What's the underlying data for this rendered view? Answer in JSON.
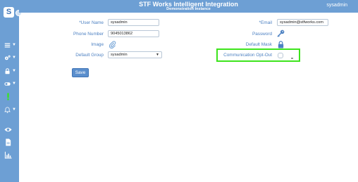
{
  "header": {
    "title": "STF Works Intelligent Integration",
    "subtitle": "Demonstration Instance",
    "user": "sysadmin"
  },
  "sidebar": {
    "logo": "S",
    "items": [
      {
        "icon": "menu-icon"
      },
      {
        "icon": "gears-icon"
      },
      {
        "icon": "lock-icon"
      },
      {
        "icon": "toggle-icon"
      },
      {
        "icon": "exclamation-icon",
        "color": "#36e61b"
      },
      {
        "icon": "bell-icon"
      },
      {
        "icon": "eye-icon"
      },
      {
        "icon": "document-icon"
      },
      {
        "icon": "bar-chart-icon"
      }
    ]
  },
  "form": {
    "user_name_label": "*User Name",
    "user_name_value": "sysadmin",
    "phone_label": "Phone Number",
    "phone_value": "9045013862",
    "image_label": "Image",
    "default_group_label": "Default Group",
    "default_group_value": "sysadmin",
    "email_label": "*Email",
    "email_value": "sysadmin@stfworks.com",
    "password_label": "Password",
    "default_mask_label": "Default Mask",
    "opt_out_label": "Communication Opt-Out",
    "save_label": "Save"
  },
  "colors": {
    "brand": "#6d9fd4",
    "label": "#4d81c2",
    "highlight": "#3de41c"
  }
}
